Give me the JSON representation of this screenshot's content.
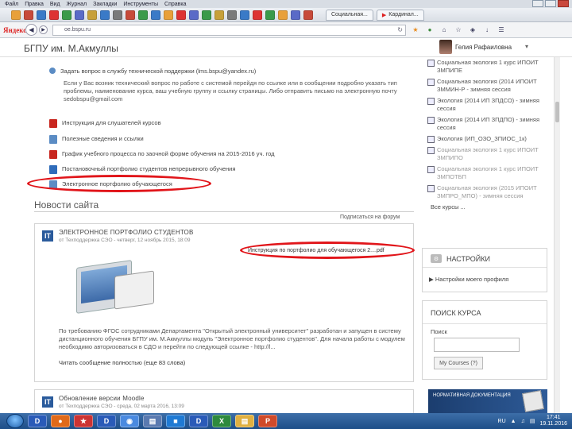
{
  "browser": {
    "menu": [
      "Файл",
      "Правка",
      "Вид",
      "Журнал",
      "Закладки",
      "Инструменты",
      "Справка"
    ],
    "tabs": [
      "Социальная...",
      "Кардинал..."
    ],
    "logo": "Яндекс",
    "address": "ое.bspu.ru"
  },
  "site": {
    "name": "БГПУ им. М.Акмуллы",
    "user_name": "Гелия Рафаиловна"
  },
  "main": {
    "support_link": "Задать вопрос в службу технической поддержки (lms.bspu@yandex.ru)",
    "support_paragraph": "Если у Вас возник технический вопрос по работе с системой перейдя по ссылке или в сообщении подробно указать тип проблемы, наименование курса, ваш учебную группу и ссылку страницы. Либо отправить письмо на электронную почту sedobspu@gmail.com",
    "resources": [
      {
        "label": "Инструкция для слушателей курсов"
      },
      {
        "label": "Полезные сведения и ссылки"
      },
      {
        "label": "График учебного процесса по заочной форме обучения на 2015-2016 уч. год"
      },
      {
        "label": "Постановочный портфолио студентов непрерывного обучения"
      },
      {
        "label": "Электронное портфолио обучающегося"
      }
    ],
    "news_title": "Новости сайта",
    "subscribe": "Подписаться на форум",
    "posts": [
      {
        "title": "ЭЛЕКТРОННОЕ ПОРТФОЛИО СТУДЕНТОВ",
        "meta": "от Техподдержка СЭО - четверг, 12 ноябрь 2015, 18:09",
        "attachment": "Инструкция по портфолио для обучающегося 2....pdf",
        "body": "По требованию ФГОС сотрудниками Департамента \"Открытый электронный университет\" разработан и запущен в систему дистанционного обучения БГПУ им. М.Акмуллы модуль \"Электронное портфолио студентов\". Для начала работы с модулем необходимо авторизоваться в СДО и перейти по следующей ссылке - http://l...",
        "read_more": "Читать сообщение полностью (еще 83 слова)"
      },
      {
        "title": "Обновление версии Moodle",
        "meta": "от Техподдержка СЭО - среда, 02 марта 2016, 13:09"
      }
    ]
  },
  "sidebar": {
    "courses": [
      {
        "label": "Социальная экология 1 курс ИПОИТ ЗМПИПЕ"
      },
      {
        "label": "Социальная экология (2014 ИПОИТ ЗММИН-Р - зимняя сессия"
      },
      {
        "label": "Экология (2014 ИП ЗПДСО) - зимняя сессия"
      },
      {
        "label": "Экология (2014 ИП ЗПДПО) - зимняя сессия"
      },
      {
        "label": "Экология (ИП_ОЗО_ЗПИОС_1к)"
      },
      {
        "label": "Социальная экология 1 курс ИПОИТ ЗМПИПО"
      },
      {
        "label": "Социальная экология 1 курс ИПОИТ ЗМПОТБП"
      },
      {
        "label": "Социальная экология (2015 ИПОИТ ЗМПРО_МПО) - зимняя сессия"
      }
    ],
    "all_courses": "Все курсы ...",
    "settings_title": "НАСТРОЙКИ",
    "settings_link": "Настройки моего профиля",
    "search_title": "ПОИСК КУРСА",
    "search_label": "Поиск",
    "search_value": "",
    "search_button": "Мy Courses (?)",
    "banner_text": "НОРМАТИВНАЯ ДОКУМЕНТАЦИЯ"
  },
  "taskbar": {
    "lang": "RU",
    "time": "17:41",
    "date": "19.11.2016"
  }
}
